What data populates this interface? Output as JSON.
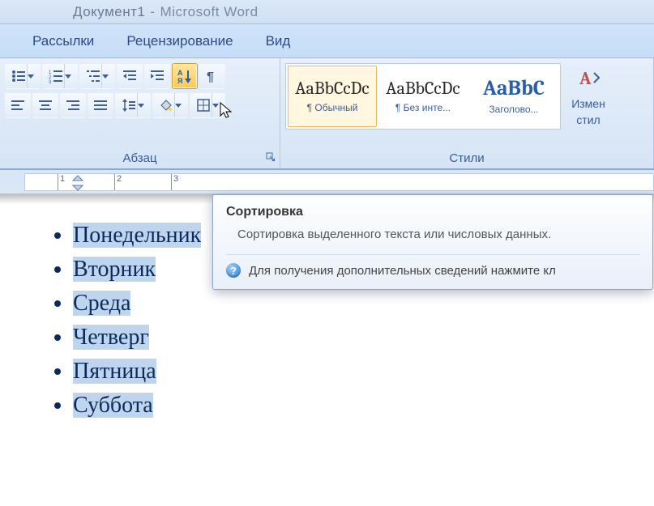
{
  "title": {
    "document": "Документ1",
    "app": "Microsoft Word",
    "sep": "-"
  },
  "tabs": {
    "mailings": "Рассылки",
    "review": "Рецензирование",
    "view": "Вид"
  },
  "paragraph_group": {
    "label": "Абзац"
  },
  "styles_group": {
    "label": "Стили",
    "items": [
      {
        "preview": "AaBbCcDc",
        "caption": "¶ Обычный"
      },
      {
        "preview": "AaBbCcDc",
        "caption": "¶ Без инте..."
      },
      {
        "preview": "AaBbC",
        "caption": "Заголово..."
      }
    ],
    "change_styles": {
      "line1": "Измен",
      "line2": "стил"
    }
  },
  "tooltip": {
    "title": "Сортировка",
    "desc": "Сортировка выделенного текста или числовых данных.",
    "help": "Для получения дополнительных сведений нажмите кл"
  },
  "ruler": {
    "marks": [
      "1",
      "2",
      "3"
    ]
  },
  "document": {
    "list_items": [
      "Понедельник",
      "Вторник",
      "Среда",
      "Четверг",
      "Пятница",
      "Суббота"
    ]
  }
}
